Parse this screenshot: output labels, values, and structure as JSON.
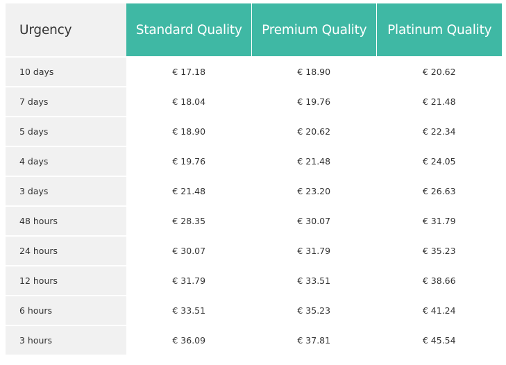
{
  "table": {
    "headers": {
      "urgency": "Urgency",
      "qualities": [
        "Standard Quality",
        "Premium Quality",
        "Platinum Quality"
      ]
    },
    "rows": [
      {
        "urgency": "10 days",
        "prices": [
          "€ 17.18",
          "€ 18.90",
          "€ 20.62"
        ]
      },
      {
        "urgency": "7 days",
        "prices": [
          "€ 18.04",
          "€ 19.76",
          "€ 21.48"
        ]
      },
      {
        "urgency": "5 days",
        "prices": [
          "€ 18.90",
          "€ 20.62",
          "€ 22.34"
        ]
      },
      {
        "urgency": "4 days",
        "prices": [
          "€ 19.76",
          "€ 21.48",
          "€ 24.05"
        ]
      },
      {
        "urgency": "3 days",
        "prices": [
          "€ 21.48",
          "€ 23.20",
          "€ 26.63"
        ]
      },
      {
        "urgency": "48 hours",
        "prices": [
          "€ 28.35",
          "€ 30.07",
          "€ 31.79"
        ]
      },
      {
        "urgency": "24 hours",
        "prices": [
          "€ 30.07",
          "€ 31.79",
          "€ 35.23"
        ]
      },
      {
        "urgency": "12 hours",
        "prices": [
          "€ 31.79",
          "€ 33.51",
          "€ 38.66"
        ]
      },
      {
        "urgency": "6 hours",
        "prices": [
          "€ 33.51",
          "€ 35.23",
          "€ 41.24"
        ]
      },
      {
        "urgency": "3 hours",
        "prices": [
          "€ 36.09",
          "€ 37.81",
          "€ 45.54"
        ]
      }
    ]
  },
  "colors": {
    "header_accent": "#3fb8a4",
    "urgency_column_bg": "#f1f1f1",
    "text": "#333333"
  }
}
